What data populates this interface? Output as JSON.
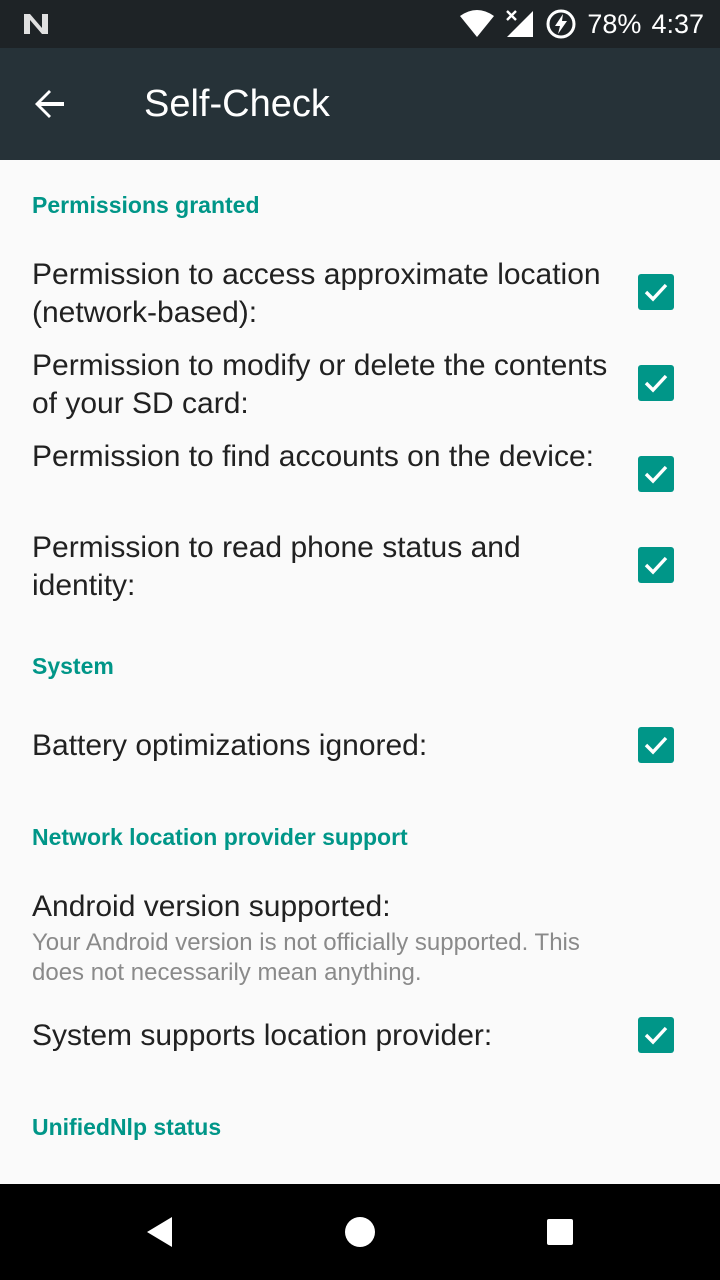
{
  "status_bar": {
    "battery_percent": "78%",
    "time": "4:37",
    "icons": [
      "android-n-icon",
      "wifi-icon",
      "no-signal-icon",
      "battery-charging-icon"
    ]
  },
  "app_bar": {
    "title": "Self-Check",
    "back_icon": "arrow-back-icon"
  },
  "sections": {
    "permissions": {
      "header": "Permissions granted",
      "items": [
        {
          "label": "Permission to access approximate location (network-based):",
          "checked": true
        },
        {
          "label": "Permission to modify or delete the contents of your SD card:",
          "checked": true
        },
        {
          "label": "Permission to find accounts on the device:",
          "checked": true
        },
        {
          "label": "Permission to read phone status and identity:",
          "checked": true
        }
      ]
    },
    "system": {
      "header": "System",
      "items": [
        {
          "label": "Battery optimizations ignored:",
          "checked": true
        }
      ]
    },
    "network": {
      "header": "Network location provider support",
      "items": [
        {
          "label": "Android version supported:",
          "sub": "Your Android version is not officially supported. This does not necessarily mean anything.",
          "checked": false
        },
        {
          "label": "System supports location provider:",
          "checked": true
        }
      ]
    },
    "unifiednlp": {
      "header": "UnifiedNlp status"
    }
  },
  "nav_bar": {
    "icons": [
      "back-triangle-icon",
      "home-circle-icon",
      "recents-square-icon"
    ]
  },
  "colors": {
    "accent": "#009688",
    "app_bar": "#263238",
    "status_bar": "#1e2326",
    "background": "#fafafa"
  }
}
